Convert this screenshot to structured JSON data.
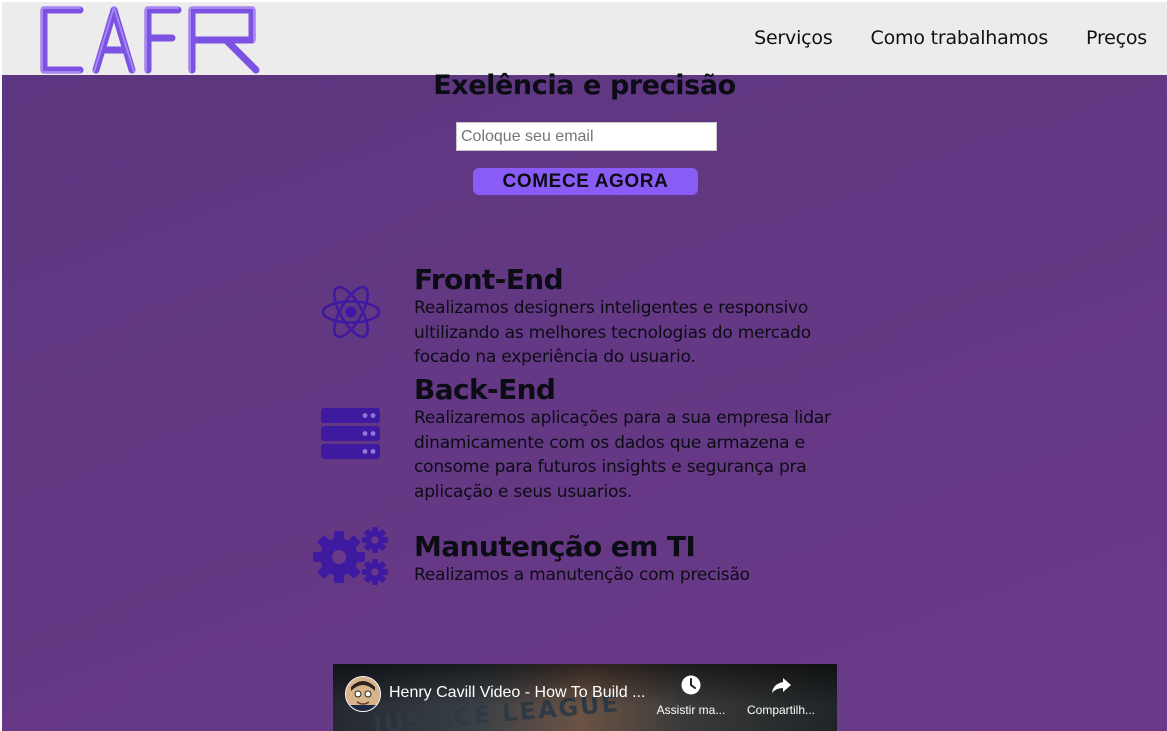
{
  "header": {
    "logo_text": "CAFR",
    "nav": [
      {
        "label": "Serviços"
      },
      {
        "label": "Como trabalhamos"
      },
      {
        "label": "Preços"
      }
    ]
  },
  "hero": {
    "title": "Exelência e precisão",
    "email_placeholder": "Coloque seu email",
    "cta_label": "COMECE AGORA"
  },
  "services": [
    {
      "title": "Front-End",
      "icon": "react-icon",
      "text": "Realizamos designers inteligentes e responsivo ultilizando as melhores tecnologias do mercado focado na experiência do usuario."
    },
    {
      "title": "Back-End",
      "icon": "server-icon",
      "text": "Realizaremos aplicações para a sua empresa lidar dinamicamente com os dados que armazena e consome para futuros insights e segurança pra aplicação e seus usuarios."
    },
    {
      "title": "Manutenção em TI",
      "icon": "gears-icon",
      "text": "Realizamos a manutenção com precisão"
    }
  ],
  "video": {
    "title": "Henry Cavill Video - How To Build ...",
    "watch_later_label": "Assistir ma...",
    "share_label": "Compartilh...",
    "background_text": "JUSTICE LEAGUE"
  },
  "colors": {
    "background": "#643884",
    "header_bg": "#ececec",
    "logo": "#7a4fe0",
    "accent_button": "#8a5cf6",
    "icon": "#3d1aa0"
  }
}
